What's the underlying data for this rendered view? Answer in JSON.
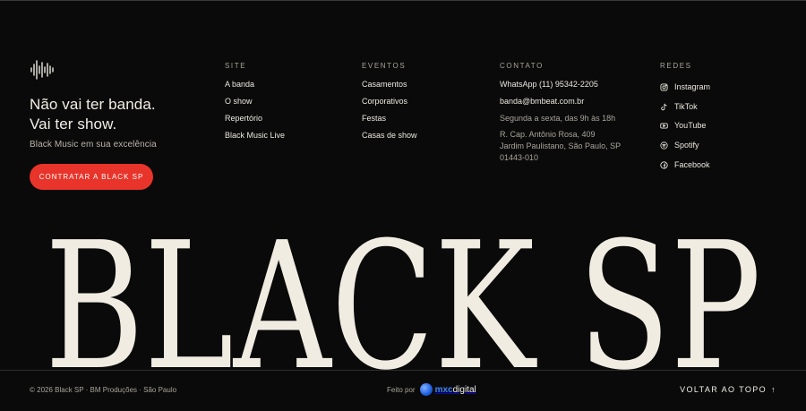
{
  "brand": {
    "logo_icon": "soundwave-icon",
    "tagline_1": "Não vai ter banda.",
    "tagline_2": "Vai ter show.",
    "subtitle": "Black Music em sua excelência",
    "cta_label": "CONTRATAR A BLACK SP",
    "accent": "#e8342a"
  },
  "site": {
    "heading": "SITE",
    "links": [
      "A banda",
      "O show",
      "Repertório",
      "Black Music Live"
    ]
  },
  "eventos": {
    "heading": "EVENTOS",
    "links": [
      "Casamentos",
      "Corporativos",
      "Festas",
      "Casas de show"
    ]
  },
  "contato": {
    "heading": "CONTATO",
    "whatsapp": "WhatsApp (11) 95342-2205",
    "email": "banda@bmbeat.com.br",
    "hours": "Segunda a sexta, das 9h às 18h",
    "address_1": "R. Cap. Antônio Rosa, 409",
    "address_2": "Jardim Paulistano, São Paulo, SP",
    "address_3": "01443-010"
  },
  "redes": {
    "heading": "REDES",
    "items": [
      {
        "label": "Instagram",
        "icon": "instagram-icon"
      },
      {
        "label": "TikTok",
        "icon": "tiktok-icon"
      },
      {
        "label": "YouTube",
        "icon": "youtube-icon"
      },
      {
        "label": "Spotify",
        "icon": "spotify-icon"
      },
      {
        "label": "Facebook",
        "icon": "facebook-icon"
      }
    ]
  },
  "wordmark": "BLACK SP",
  "footer": {
    "copyright": "© 2026 Black SP · BM Produções · São Paulo",
    "made_by_label": "Feito por",
    "agency_prefix": "mxc",
    "agency_suffix": "digital",
    "back_to_top": "VOLTAR AO TOPO",
    "back_to_top_arrow": "↑"
  }
}
